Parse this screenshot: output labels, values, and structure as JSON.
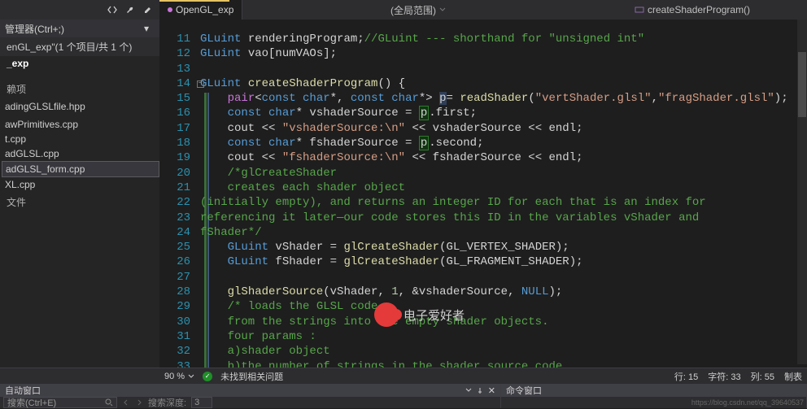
{
  "tab": {
    "name": "OpenGL_exp"
  },
  "scope": "(全局范围)",
  "member": "createShaderProgram()",
  "side": {
    "header": "管理器(Ctrl+;)",
    "info": "enGL_exp\"(1 个项目/共 1 个)",
    "bold": "_exp",
    "section": "赖项",
    "files": [
      "adingGLSLfile.hpp",
      "",
      "awPrimitives.cpp",
      "t.cpp",
      "adGLSL.cpp",
      "adGLSL_form.cpp",
      "XL.cpp"
    ],
    "section2": "文件",
    "selectedIndex": 5
  },
  "gutterStart": 11,
  "gutterCount": 23,
  "code": [
    [
      {
        "c": "k1",
        "t": "GLuint"
      },
      {
        "c": "id",
        "t": " renderingProgram;"
      },
      {
        "c": "cmt",
        "t": "//GLuint --- shorthand for \"unsigned int\""
      }
    ],
    [
      {
        "c": "k1",
        "t": "GLuint"
      },
      {
        "c": "id",
        "t": " vao[numVAOs];"
      }
    ],
    [],
    [
      {
        "c": "k1",
        "t": "GLuint"
      },
      {
        "c": "id",
        "t": " "
      },
      {
        "c": "fn",
        "t": "createShaderProgram"
      },
      {
        "c": "id",
        "t": "() {"
      }
    ],
    [
      {
        "c": "id",
        "t": "    "
      },
      {
        "c": "k2",
        "t": "pair"
      },
      {
        "c": "id",
        "t": "<"
      },
      {
        "c": "k1",
        "t": "const char"
      },
      {
        "c": "id",
        "t": "*, "
      },
      {
        "c": "k1",
        "t": "const char"
      },
      {
        "c": "id",
        "t": "*> "
      },
      {
        "c": "hl1",
        "t": "p"
      },
      {
        "c": "id",
        "t": "= "
      },
      {
        "c": "fn",
        "t": "readShader"
      },
      {
        "c": "id",
        "t": "("
      },
      {
        "c": "str",
        "t": "\"vertShader.glsl\""
      },
      {
        "c": "id",
        "t": ","
      },
      {
        "c": "str",
        "t": "\"fragShader.glsl\""
      },
      {
        "c": "id",
        "t": ");"
      }
    ],
    [
      {
        "c": "id",
        "t": "    "
      },
      {
        "c": "k1",
        "t": "const char"
      },
      {
        "c": "id",
        "t": "* vshaderSource = "
      },
      {
        "c": "hl2",
        "t": "p"
      },
      {
        "c": "id",
        "t": ".first;"
      }
    ],
    [
      {
        "c": "id",
        "t": "    cout << "
      },
      {
        "c": "str",
        "t": "\"vshaderSource:\\n\""
      },
      {
        "c": "id",
        "t": " << vshaderSource << endl;"
      }
    ],
    [
      {
        "c": "id",
        "t": "    "
      },
      {
        "c": "k1",
        "t": "const char"
      },
      {
        "c": "id",
        "t": "* fshaderSource = "
      },
      {
        "c": "hl2",
        "t": "p"
      },
      {
        "c": "id",
        "t": ".second;"
      }
    ],
    [
      {
        "c": "id",
        "t": "    cout << "
      },
      {
        "c": "str",
        "t": "\"fshaderSource:\\n\""
      },
      {
        "c": "id",
        "t": " << fshaderSource << endl;"
      }
    ],
    [
      {
        "c": "id",
        "t": "    "
      },
      {
        "c": "cmt",
        "t": "/*glCreateShader"
      }
    ],
    [
      {
        "c": "cmt",
        "t": "    creates each shader object"
      }
    ],
    [
      {
        "c": "cmt",
        "t": "(initially empty), and returns an integer ID for each that is an index for"
      }
    ],
    [
      {
        "c": "cmt",
        "t": "referencing it later—our code stores this ID in the variables vShader and"
      }
    ],
    [
      {
        "c": "cmt",
        "t": "fShader*/"
      }
    ],
    [
      {
        "c": "id",
        "t": "    "
      },
      {
        "c": "k1",
        "t": "GLuint"
      },
      {
        "c": "id",
        "t": " vShader = "
      },
      {
        "c": "fn",
        "t": "glCreateShader"
      },
      {
        "c": "id",
        "t": "(GL_VERTEX_SHADER);"
      }
    ],
    [
      {
        "c": "id",
        "t": "    "
      },
      {
        "c": "k1",
        "t": "GLuint"
      },
      {
        "c": "id",
        "t": " fShader = "
      },
      {
        "c": "fn",
        "t": "glCreateShader"
      },
      {
        "c": "id",
        "t": "(GL_FRAGMENT_SHADER);"
      }
    ],
    [],
    [
      {
        "c": "id",
        "t": "    "
      },
      {
        "c": "fn",
        "t": "glShaderSource"
      },
      {
        "c": "id",
        "t": "(vShader, "
      },
      {
        "c": "num",
        "t": "1"
      },
      {
        "c": "id",
        "t": ", &vshaderSource, "
      },
      {
        "c": "k1",
        "t": "NULL"
      },
      {
        "c": "id",
        "t": ");"
      }
    ],
    [
      {
        "c": "id",
        "t": "    "
      },
      {
        "c": "cmt",
        "t": "/* loads the GLSL code"
      }
    ],
    [
      {
        "c": "cmt",
        "t": "    from the strings into the empty shader objects."
      }
    ],
    [
      {
        "c": "cmt",
        "t": "    four params :"
      }
    ],
    [
      {
        "c": "cmt",
        "t": "    a)shader object"
      }
    ],
    [
      {
        "c": "cmt",
        "t": "    b)the number of strings in the shader source code"
      }
    ]
  ],
  "status": {
    "zoom": "90 %",
    "issues": "未找到相关问题",
    "line": "行: 15",
    "char": "字符: 33",
    "col": "列: 55",
    "extra": "制表"
  },
  "panels": {
    "left": {
      "title": "自动窗口",
      "search_placeholder": "搜索(Ctrl+E)",
      "depth_label": "搜索深度:",
      "depth": "3"
    },
    "right": {
      "title": "命令窗口"
    }
  },
  "watermark": "电子爱好者",
  "footer_url": "https://blog.csdn.net/qq_39640537"
}
